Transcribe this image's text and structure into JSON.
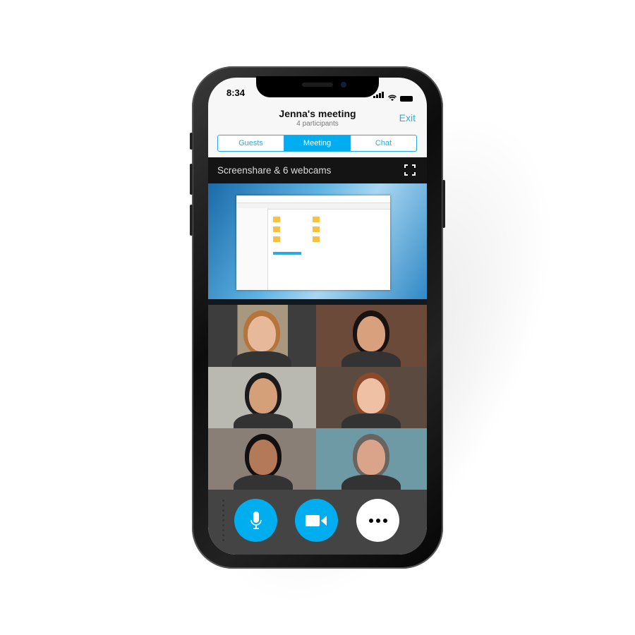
{
  "status_bar": {
    "time": "8:34"
  },
  "header": {
    "title": "Jenna's meeting",
    "subtitle": "4 participants",
    "exit_label": "Exit"
  },
  "tabs": [
    {
      "label": "Guests",
      "active": false
    },
    {
      "label": "Meeting",
      "active": true
    },
    {
      "label": "Chat",
      "active": false
    }
  ],
  "stage": {
    "label": "Screenshare & 6 webcams",
    "fullscreen_icon": "fullscreen-icon"
  },
  "webcams": [
    {
      "bg": "#3d3d3d",
      "face": "#e8b89a",
      "hair": "#b4743c"
    },
    {
      "bg": "#6b4a3a",
      "face": "#d9a07e",
      "hair": "#1a1210"
    },
    {
      "bg": "#b9b9b2",
      "face": "#d4a07a",
      "hair": "#1b1b1b"
    },
    {
      "bg": "#5a4a40",
      "face": "#f0c0a4",
      "hair": "#8a4a2a"
    },
    {
      "bg": "#8a7f76",
      "face": "#b27a58",
      "hair": "#141010"
    },
    {
      "bg": "#6e9aa6",
      "face": "#d9a48a",
      "hair": "#6a6460"
    }
  ],
  "controls": [
    {
      "name": "microphone",
      "icon": "microphone-icon"
    },
    {
      "name": "video",
      "icon": "video-camera-icon"
    },
    {
      "name": "more",
      "icon": "more-icon"
    }
  ],
  "colors": {
    "accent": "#00aeef",
    "text_accent": "#29abe2",
    "control_bar": "#444444"
  }
}
